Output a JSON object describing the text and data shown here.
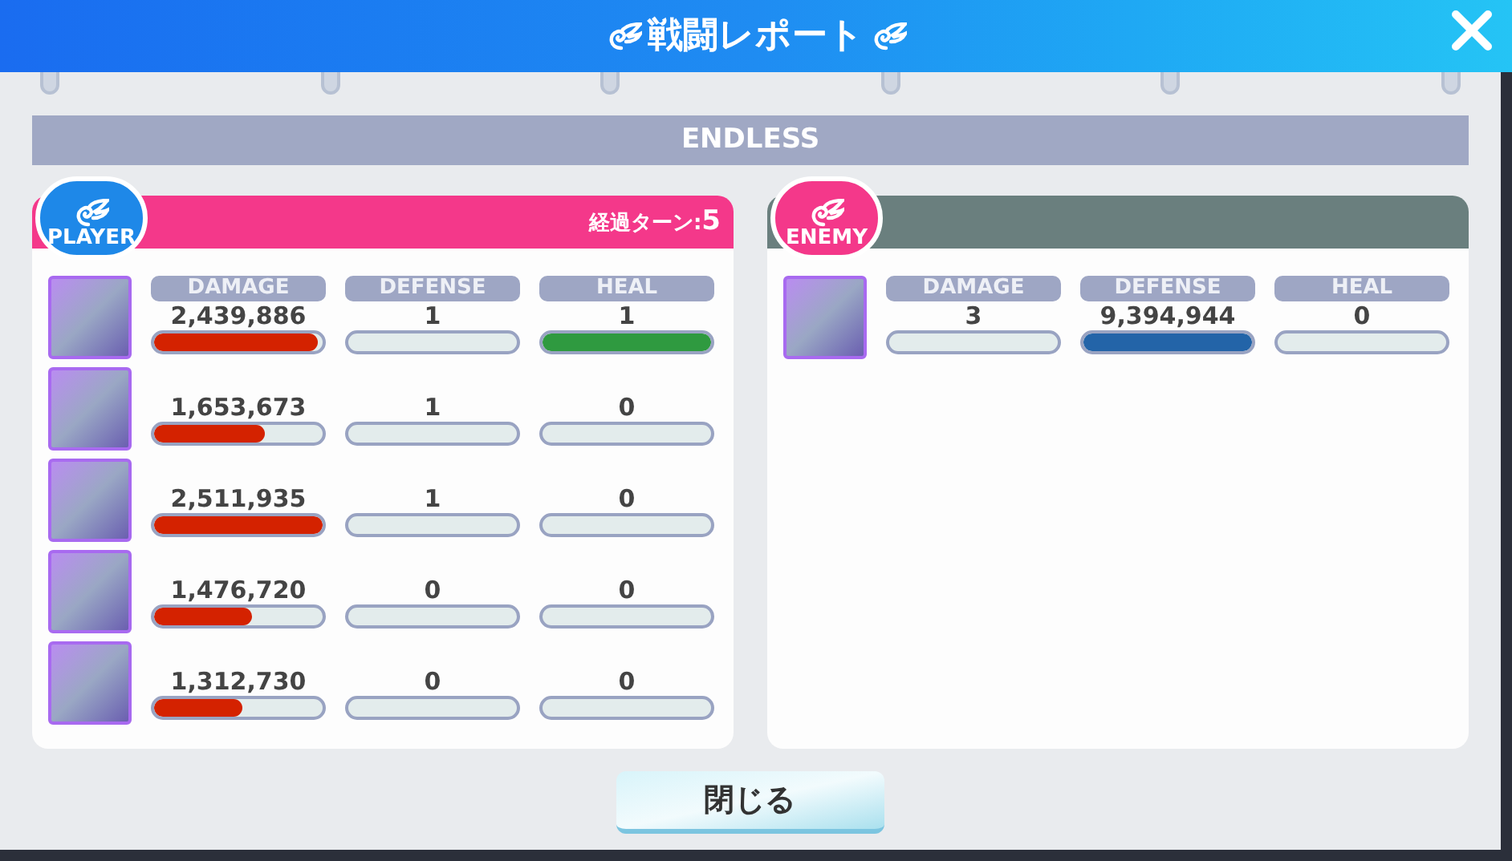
{
  "window": {
    "title": "戦闘レポート"
  },
  "mode": "ENDLESS",
  "player": {
    "badge": "PLAYER",
    "turn_label": "経過ターン:",
    "turn_count": "5",
    "columns": [
      {
        "label": "DAMAGE"
      },
      {
        "label": "DEFENSE"
      },
      {
        "label": "HEAL"
      }
    ],
    "rows": [
      {
        "cells": [
          {
            "value": "2,439,886",
            "level": 0.97
          },
          {
            "value": "1",
            "level": 0
          },
          {
            "value": "1",
            "level": 1
          }
        ]
      },
      {
        "cells": [
          {
            "value": "1,653,673",
            "level": 0.66
          },
          {
            "value": "1",
            "level": 0
          },
          {
            "value": "0",
            "level": 0
          }
        ]
      },
      {
        "cells": [
          {
            "value": "2,511,935",
            "level": 1
          },
          {
            "value": "1",
            "level": 0
          },
          {
            "value": "0",
            "level": 0
          }
        ]
      },
      {
        "cells": [
          {
            "value": "1,476,720",
            "level": 0.58
          },
          {
            "value": "0",
            "level": 0
          },
          {
            "value": "0",
            "level": 0
          }
        ]
      },
      {
        "cells": [
          {
            "value": "1,312,730",
            "level": 0.52
          },
          {
            "value": "0",
            "level": 0
          },
          {
            "value": "0",
            "level": 0
          }
        ]
      }
    ]
  },
  "enemy": {
    "badge": "ENEMY",
    "columns": [
      {
        "label": "DAMAGE"
      },
      {
        "label": "DEFENSE"
      },
      {
        "label": "HEAL"
      }
    ],
    "rows": [
      {
        "cells": [
          {
            "value": "3",
            "level": 0
          },
          {
            "value": "9,394,944",
            "level": 1
          },
          {
            "value": "0",
            "level": 0
          }
        ]
      }
    ]
  },
  "close_button": "閉じる"
}
